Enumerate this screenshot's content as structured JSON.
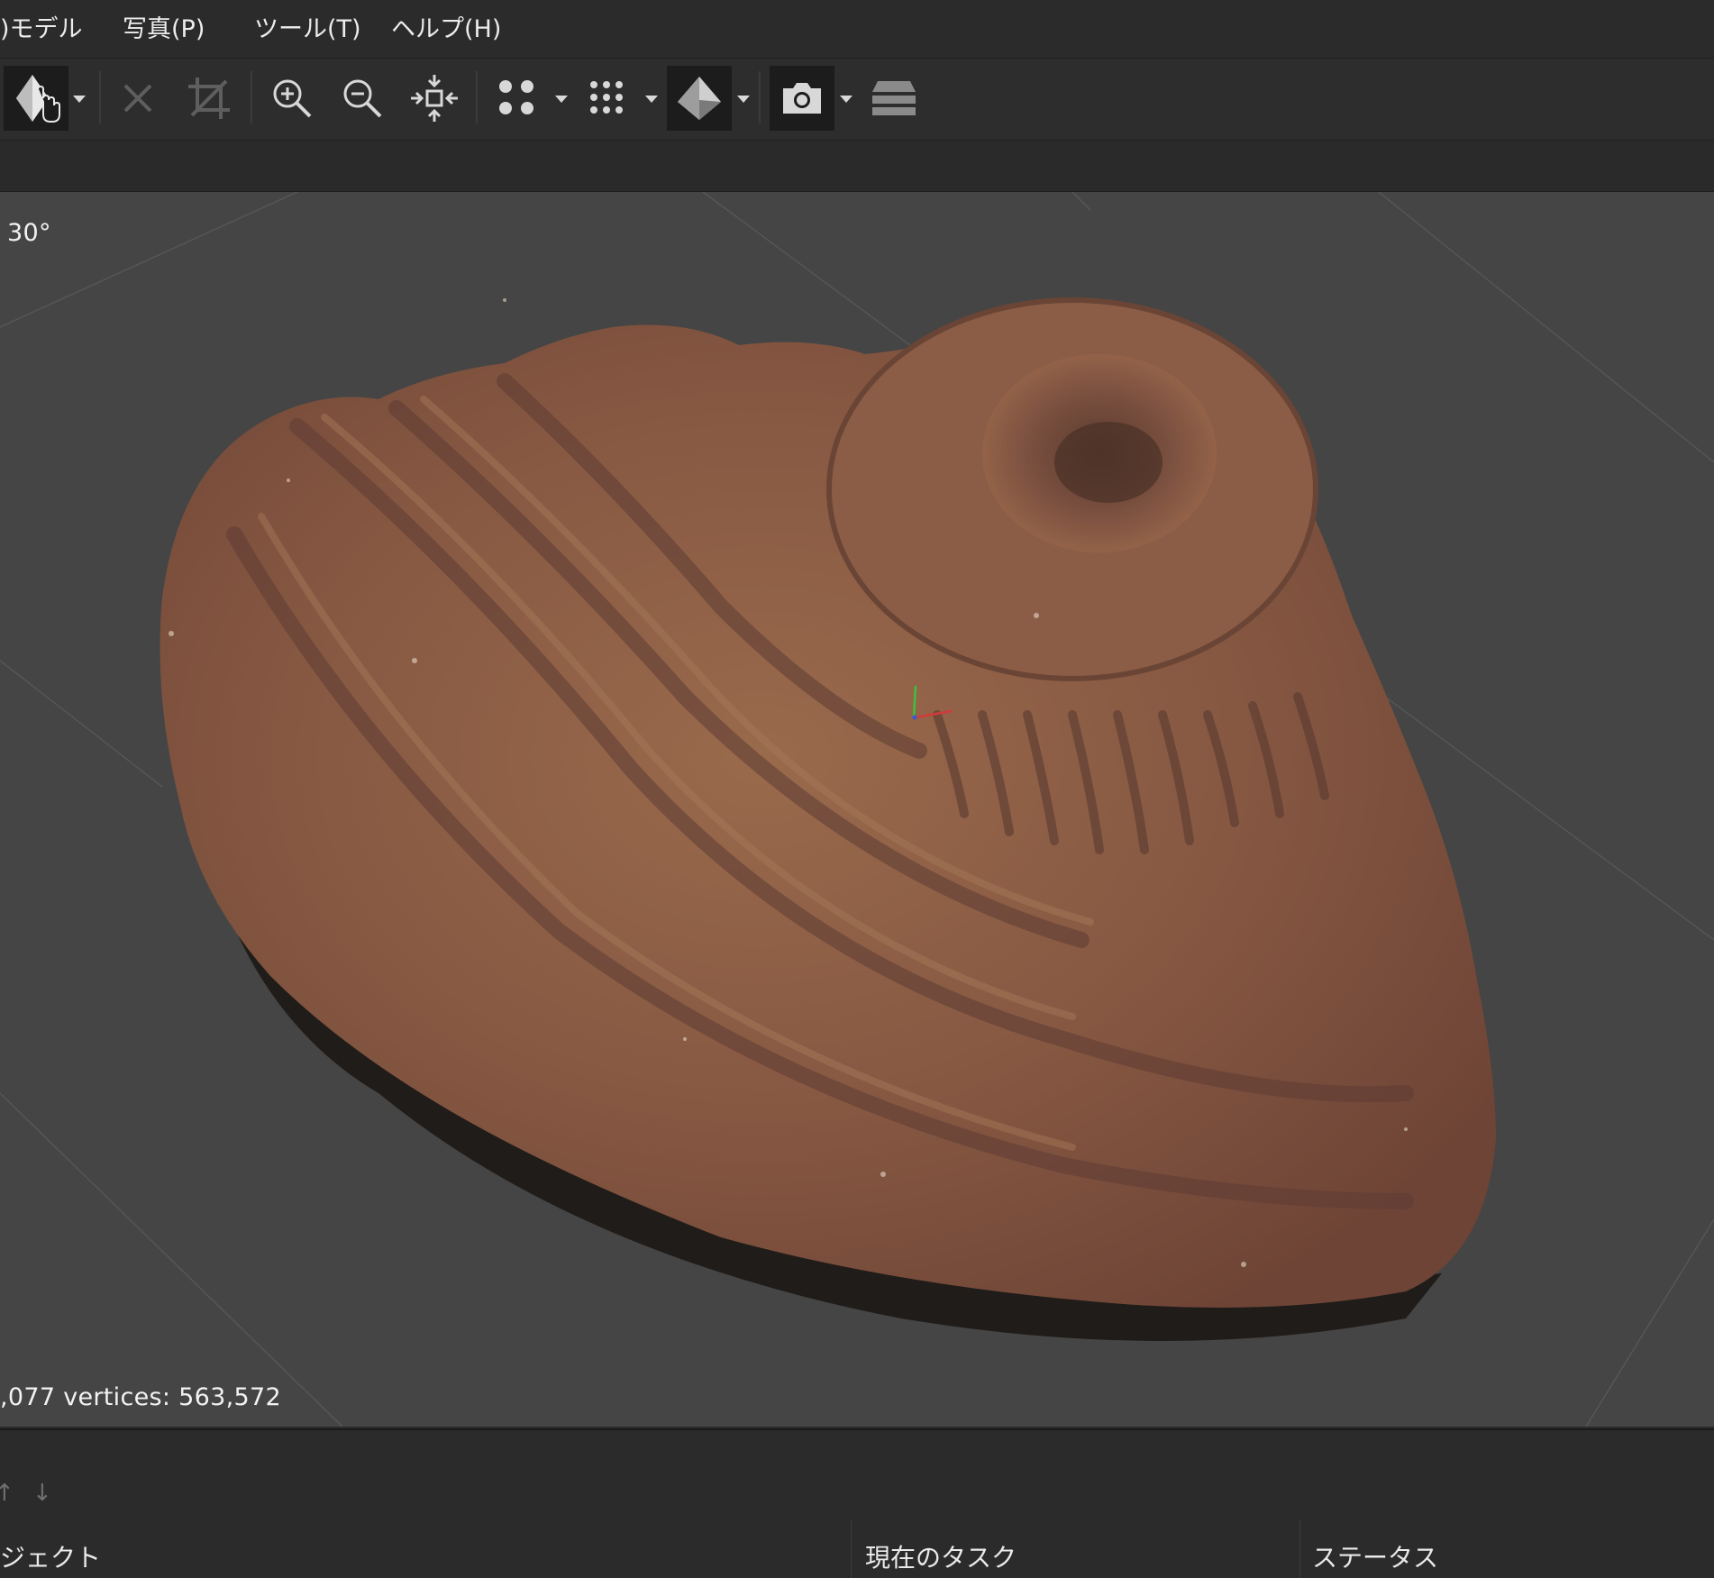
{
  "menu": {
    "items": [
      ")モデル",
      "写真(P)",
      "ツール(T)",
      "ヘルプ(H)"
    ]
  },
  "toolbar": {
    "buttons": [
      {
        "icon": "navigation-mode-icon",
        "has_dropdown": true,
        "active": true
      },
      {
        "icon": "delete-selection-icon",
        "has_dropdown": false,
        "disabled": true
      },
      {
        "icon": "crop-selection-icon",
        "has_dropdown": false,
        "disabled": true
      },
      {
        "icon": "zoom-in-icon",
        "has_dropdown": false
      },
      {
        "icon": "zoom-out-icon",
        "has_dropdown": false
      },
      {
        "icon": "reset-view-icon",
        "has_dropdown": false
      },
      {
        "icon": "point-cloud-icon",
        "has_dropdown": true
      },
      {
        "icon": "dense-cloud-icon",
        "has_dropdown": true
      },
      {
        "icon": "textured-model-icon",
        "has_dropdown": true,
        "active": true
      },
      {
        "icon": "show-cameras-icon",
        "has_dropdown": true,
        "active": true
      },
      {
        "icon": "show-layers-icon",
        "has_dropdown": false
      }
    ]
  },
  "viewport": {
    "angle_label": "30°",
    "stats_label": ",077 vertices: 563,572",
    "background": "#454545",
    "axis_colors": {
      "x": "#d23a3a",
      "y": "#3fbf3f",
      "z": "#3a5ad2"
    }
  },
  "bottom_panel": {
    "columns": [
      "ジェクト",
      "現在のタスク",
      "ステータス"
    ]
  }
}
